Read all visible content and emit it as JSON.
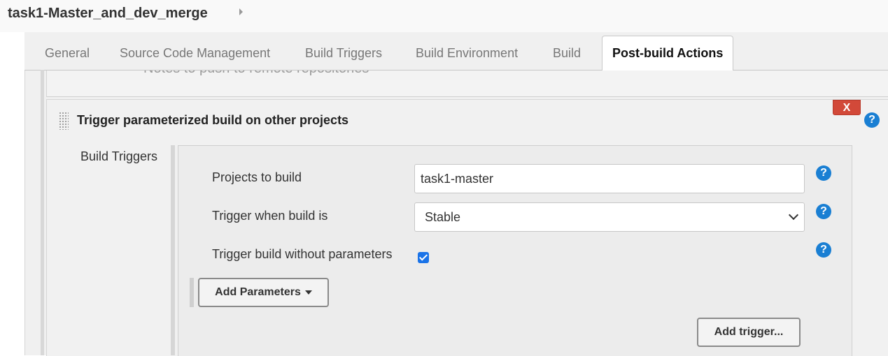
{
  "breadcrumb": {
    "job_name": "task1-Master_and_dev_merge"
  },
  "tabs": [
    {
      "label": "General"
    },
    {
      "label": "Source Code Management"
    },
    {
      "label": "Build Triggers"
    },
    {
      "label": "Build Environment"
    },
    {
      "label": "Build"
    },
    {
      "label": "Post-build Actions"
    }
  ],
  "active_tab": "Post-build Actions",
  "previous_section": {
    "text": "Notes to push to remote repositories"
  },
  "section": {
    "title": "Trigger parameterized build on other projects",
    "delete_label": "X",
    "help_label": "?",
    "build_triggers_label": "Build Triggers",
    "fields": {
      "projects_label": "Projects to build",
      "projects_value": "task1-master",
      "trigger_when_label": "Trigger when build is",
      "trigger_when_value": "Stable",
      "without_params_label": "Trigger build without parameters",
      "without_params_checked": true
    },
    "add_parameters_label": "Add Parameters",
    "add_trigger_label": "Add trigger..."
  },
  "colors": {
    "help_blue": "#1a7fd3",
    "delete_red": "#d24939",
    "checkbox_blue": "#1a73e8"
  }
}
